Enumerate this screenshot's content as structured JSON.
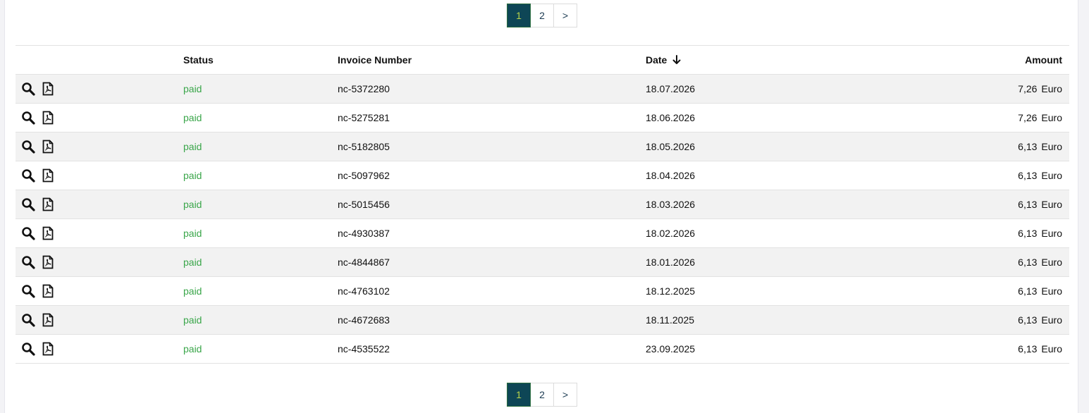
{
  "pagination": {
    "pages": [
      "1",
      "2"
    ],
    "next_label": ">",
    "active_page": "1"
  },
  "table": {
    "headers": {
      "status": "Status",
      "invoice_number": "Invoice Number",
      "date": "Date",
      "amount": "Amount"
    },
    "sort": {
      "column": "date",
      "direction": "desc",
      "icon": "arrow-down-icon"
    },
    "row_icons": [
      "search-icon",
      "pdf-file-icon"
    ],
    "colors": {
      "paid": "#3aa64a",
      "active_page_bg": "#0e4656",
      "active_page_text": "#b8d34a"
    },
    "rows": [
      {
        "status": "paid",
        "invoice": "nc-5372280",
        "date": "18.07.2026",
        "amount": "7,26",
        "currency": "Euro"
      },
      {
        "status": "paid",
        "invoice": "nc-5275281",
        "date": "18.06.2026",
        "amount": "7,26",
        "currency": "Euro"
      },
      {
        "status": "paid",
        "invoice": "nc-5182805",
        "date": "18.05.2026",
        "amount": "6,13",
        "currency": "Euro"
      },
      {
        "status": "paid",
        "invoice": "nc-5097962",
        "date": "18.04.2026",
        "amount": "6,13",
        "currency": "Euro"
      },
      {
        "status": "paid",
        "invoice": "nc-5015456",
        "date": "18.03.2026",
        "amount": "6,13",
        "currency": "Euro"
      },
      {
        "status": "paid",
        "invoice": "nc-4930387",
        "date": "18.02.2026",
        "amount": "6,13",
        "currency": "Euro"
      },
      {
        "status": "paid",
        "invoice": "nc-4844867",
        "date": "18.01.2026",
        "amount": "6,13",
        "currency": "Euro"
      },
      {
        "status": "paid",
        "invoice": "nc-4763102",
        "date": "18.12.2025",
        "amount": "6,13",
        "currency": "Euro"
      },
      {
        "status": "paid",
        "invoice": "nc-4672683",
        "date": "18.11.2025",
        "amount": "6,13",
        "currency": "Euro"
      },
      {
        "status": "paid",
        "invoice": "nc-4535522",
        "date": "23.09.2025",
        "amount": "6,13",
        "currency": "Euro"
      }
    ]
  }
}
